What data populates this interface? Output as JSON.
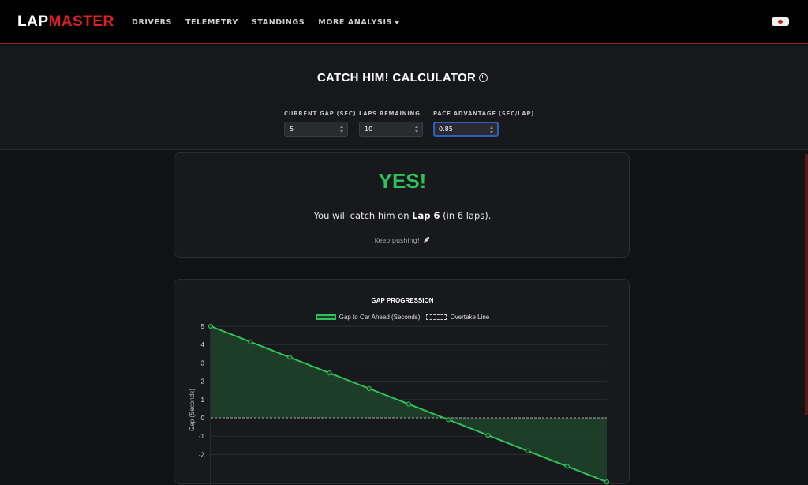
{
  "brand": {
    "part1": "LAP",
    "part2": "MASTER"
  },
  "nav": {
    "items": [
      "DRIVERS",
      "TELEMETRY",
      "STANDINGS"
    ],
    "more": "MORE ANALYSIS"
  },
  "calculator": {
    "title": "CATCH HIM! CALCULATOR",
    "fields": [
      {
        "label": "CURRENT GAP (SEC)",
        "value": "5"
      },
      {
        "label": "LAPS REMAINING",
        "value": "10"
      },
      {
        "label": "PACE ADVANTAGE (SEC/LAP)",
        "value": "0.85"
      }
    ]
  },
  "result": {
    "verdict": "YES!",
    "message_prefix": "You will catch him on ",
    "message_lap": "Lap 6",
    "message_suffix": " (in 6 laps).",
    "encouragement": "Keep pushing!"
  },
  "colors": {
    "accent": "#2ec25a",
    "brand_red": "#e0201f",
    "focus_blue": "#2f5fbf"
  },
  "icons": [
    "stopwatch-icon",
    "rocket-icon",
    "chevron-down-icon"
  ],
  "chart_data": {
    "type": "area",
    "title": "GAP PROGRESSION",
    "ylabel": "Gap (Seconds)",
    "xlabel": "",
    "x": [
      0,
      1,
      2,
      3,
      4,
      5,
      6,
      7,
      8,
      9,
      10
    ],
    "series": [
      {
        "name": "Gap to Car Ahead (Seconds)",
        "values": [
          5,
          4.15,
          3.3,
          2.45,
          1.6,
          0.75,
          -0.1,
          -0.95,
          -1.8,
          -2.65,
          -3.5
        ]
      },
      {
        "name": "Overtake Line",
        "values": [
          0,
          0,
          0,
          0,
          0,
          0,
          0,
          0,
          0,
          0,
          0
        ]
      }
    ],
    "yticks": [
      5,
      4,
      3,
      2,
      1,
      0,
      -1,
      -2
    ],
    "ylim": [
      -2.4,
      5
    ],
    "xlim": [
      0,
      10
    ],
    "grid": true,
    "legend_position": "top"
  }
}
